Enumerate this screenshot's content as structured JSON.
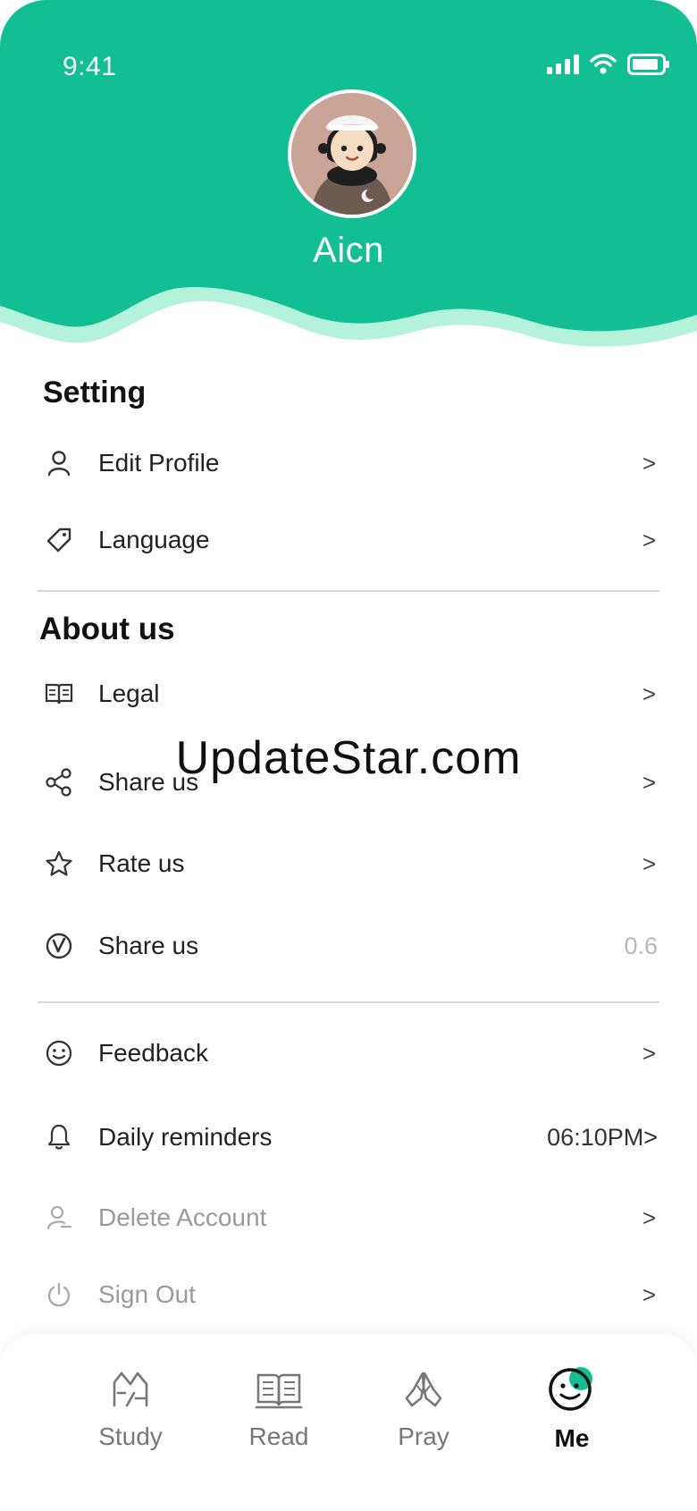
{
  "status": {
    "time": "9:41"
  },
  "profile": {
    "name": "Aicn"
  },
  "colors": {
    "accent": "#12bf92",
    "wave_light": "#b4f2dc"
  },
  "sections": [
    {
      "title": "Setting",
      "items": [
        {
          "label": "Edit Profile",
          "icon": "user-icon",
          "right": ">"
        },
        {
          "label": "Language",
          "icon": "tag-icon",
          "right": ">"
        }
      ]
    },
    {
      "title": "About us",
      "items": [
        {
          "label": "Legal",
          "icon": "book-icon",
          "right": ">"
        },
        {
          "label": "Share us",
          "icon": "share-icon",
          "right": ">"
        },
        {
          "label": "Rate us",
          "icon": "star-icon",
          "right": ">"
        },
        {
          "label": "Share us",
          "icon": "version-icon",
          "right": "0.6"
        }
      ]
    },
    {
      "title": "",
      "items": [
        {
          "label": "Feedback",
          "icon": "smile-icon",
          "right": ">"
        },
        {
          "label": "Daily reminders",
          "icon": "bell-icon",
          "right": "06:10PM>"
        },
        {
          "label": "Delete Account",
          "icon": "user-minus-icon",
          "right": ">"
        },
        {
          "label": "Sign Out",
          "icon": "power-icon",
          "right": ">"
        }
      ]
    }
  ],
  "watermark": "UpdateStar.com",
  "tabs": [
    {
      "label": "Study",
      "icon": "study-icon"
    },
    {
      "label": "Read",
      "icon": "open-book-icon"
    },
    {
      "label": "Pray",
      "icon": "praying-hands-icon"
    },
    {
      "label": "Me",
      "icon": "me-face-icon",
      "active": true
    }
  ]
}
